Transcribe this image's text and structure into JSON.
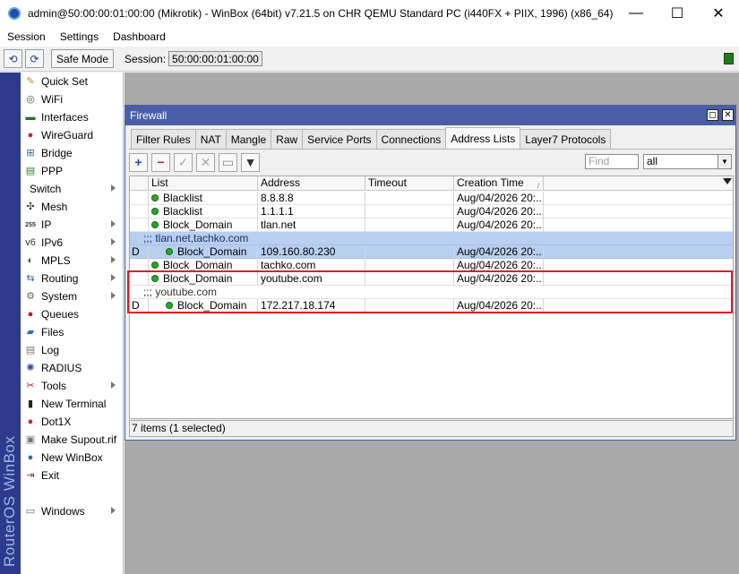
{
  "window": {
    "title": "admin@50:00:00:01:00:00 (Mikrotik) - WinBox (64bit) v7.21.5 on CHR QEMU Standard PC (i440FX + PIIX, 1996) (x86_64)",
    "controls": {
      "minimize": "—",
      "maximize": "☐",
      "close": "✕"
    }
  },
  "menu": [
    "Session",
    "Settings",
    "Dashboard"
  ],
  "toolbar": {
    "undo": "⟲",
    "redo": "⟳",
    "safe_mode": "Safe Mode",
    "session_label": "Session:",
    "session_value": "50:00:00:01:00:00"
  },
  "brand": "RouterOS WinBox",
  "sidebar": [
    {
      "label": "Quick Set",
      "icon": "quick-set-icon",
      "glyph": "✎",
      "color": "#c98a1a",
      "submenu": false
    },
    {
      "label": "WiFi",
      "icon": "wifi-icon",
      "glyph": "◎",
      "color": "#555555",
      "submenu": false
    },
    {
      "label": "Interfaces",
      "icon": "interfaces-icon",
      "glyph": "▬",
      "color": "#1d7a1d",
      "submenu": false
    },
    {
      "label": "WireGuard",
      "icon": "wireguard-icon",
      "glyph": "●",
      "color": "#c0262d",
      "submenu": false
    },
    {
      "label": "Bridge",
      "icon": "bridge-icon",
      "glyph": "⊞",
      "color": "#3060a8",
      "submenu": false
    },
    {
      "label": "PPP",
      "icon": "ppp-icon",
      "glyph": "▤",
      "color": "#2e7d32",
      "submenu": false
    },
    {
      "label": "Switch",
      "icon": "",
      "glyph": "",
      "color": "#000000",
      "submenu": true
    },
    {
      "label": "Mesh",
      "icon": "mesh-icon",
      "glyph": "✣",
      "color": "#333333",
      "submenu": false
    },
    {
      "label": "IP",
      "icon": "ip-icon",
      "glyph": "255",
      "color": "#333333",
      "submenu": true
    },
    {
      "label": "IPv6",
      "icon": "ipv6-icon",
      "glyph": "v6",
      "color": "#333333",
      "submenu": true
    },
    {
      "label": "MPLS",
      "icon": "mpls-icon",
      "glyph": "◐",
      "color": "#444444",
      "submenu": true
    },
    {
      "label": "Routing",
      "icon": "routing-icon",
      "glyph": "⇆",
      "color": "#2b63b5",
      "submenu": true
    },
    {
      "label": "System",
      "icon": "system-icon",
      "glyph": "⚙",
      "color": "#666666",
      "submenu": true
    },
    {
      "label": "Queues",
      "icon": "queues-icon",
      "glyph": "●",
      "color": "#b01e1e",
      "submenu": false
    },
    {
      "label": "Files",
      "icon": "files-icon",
      "glyph": "▰",
      "color": "#2f6fc0",
      "submenu": false
    },
    {
      "label": "Log",
      "icon": "log-icon",
      "glyph": "▤",
      "color": "#777777",
      "submenu": false
    },
    {
      "label": "RADIUS",
      "icon": "radius-icon",
      "glyph": "✺",
      "color": "#2f4fa8",
      "submenu": false
    },
    {
      "label": "Tools",
      "icon": "tools-icon",
      "glyph": "✂",
      "color": "#b01e1e",
      "submenu": true
    },
    {
      "label": "New Terminal",
      "icon": "terminal-icon",
      "glyph": "▮",
      "color": "#222222",
      "submenu": false
    },
    {
      "label": "Dot1X",
      "icon": "dot1x-icon",
      "glyph": "●",
      "color": "#c0262d",
      "submenu": false
    },
    {
      "label": "Make Supout.rif",
      "icon": "supout-icon",
      "glyph": "▣",
      "color": "#777777",
      "submenu": false
    },
    {
      "label": "New WinBox",
      "icon": "winbox-icon",
      "glyph": "●",
      "color": "#2f6fc0",
      "submenu": false
    },
    {
      "label": "Exit",
      "icon": "exit-icon",
      "glyph": "⇥",
      "color": "#b01e1e",
      "submenu": false
    },
    {
      "label": "Windows",
      "icon": "windows-icon",
      "glyph": "▭",
      "color": "#2f6fc0",
      "submenu": true
    }
  ],
  "firewall": {
    "title": "Firewall",
    "buttons": {
      "restore": "◻",
      "close": "✕"
    },
    "tabs": [
      "Filter Rules",
      "NAT",
      "Mangle",
      "Raw",
      "Service Ports",
      "Connections",
      "Address Lists",
      "Layer7 Protocols"
    ],
    "active_tab": "Address Lists",
    "tools": {
      "add": "+",
      "remove": "−",
      "enable": "✓",
      "disable": "✕",
      "comment": "▭",
      "filter": "▼"
    },
    "find_placeholder": "Find",
    "filter_value": "all",
    "columns": [
      "List",
      "Address",
      "Timeout",
      "Creation Time"
    ],
    "rows": [
      {
        "flag": "",
        "list": "Blacklist",
        "address": "8.8.8.8",
        "timeout": "",
        "created": "Aug/04/2026 20:...",
        "indent": false,
        "selected": false,
        "comment": null
      },
      {
        "flag": "",
        "list": "Blacklist",
        "address": "1.1.1.1",
        "timeout": "",
        "created": "Aug/04/2026 20:...",
        "indent": false,
        "selected": false,
        "comment": null
      },
      {
        "flag": "",
        "list": "Block_Domain",
        "address": "tlan.net",
        "timeout": "",
        "created": "Aug/04/2026 20:...",
        "indent": false,
        "selected": false,
        "comment": null
      },
      {
        "flag": "",
        "list": "",
        "address": "",
        "timeout": "",
        "created": "",
        "indent": false,
        "selected": true,
        "comment": ";;; tlan.net,tachko.com"
      },
      {
        "flag": "D",
        "list": "Block_Domain",
        "address": "109.160.80.230",
        "timeout": "",
        "created": "Aug/04/2026 20:...",
        "indent": true,
        "selected": true,
        "comment": null
      },
      {
        "flag": "",
        "list": "Block_Domain",
        "address": "tachko.com",
        "timeout": "",
        "created": "Aug/04/2026 20:...",
        "indent": false,
        "selected": false,
        "comment": null
      },
      {
        "flag": "",
        "list": "Block_Domain",
        "address": "youtube.com",
        "timeout": "",
        "created": "Aug/04/2026 20:...",
        "indent": false,
        "selected": false,
        "comment": null
      },
      {
        "flag": "",
        "list": "",
        "address": "",
        "timeout": "",
        "created": "",
        "indent": false,
        "selected": false,
        "comment": ";;; youtube.com"
      },
      {
        "flag": "D",
        "list": "Block_Domain",
        "address": "172.217.18.174",
        "timeout": "",
        "created": "Aug/04/2026 20:...",
        "indent": true,
        "selected": false,
        "comment": null
      }
    ],
    "status": "7 items (1 selected)"
  },
  "colors": {
    "accent": "#4a5ea8",
    "brand_band": "#2e3a8c",
    "selection": "#b8cff0",
    "highlight_box": "#e01b24",
    "status_dot": "#27a827"
  }
}
